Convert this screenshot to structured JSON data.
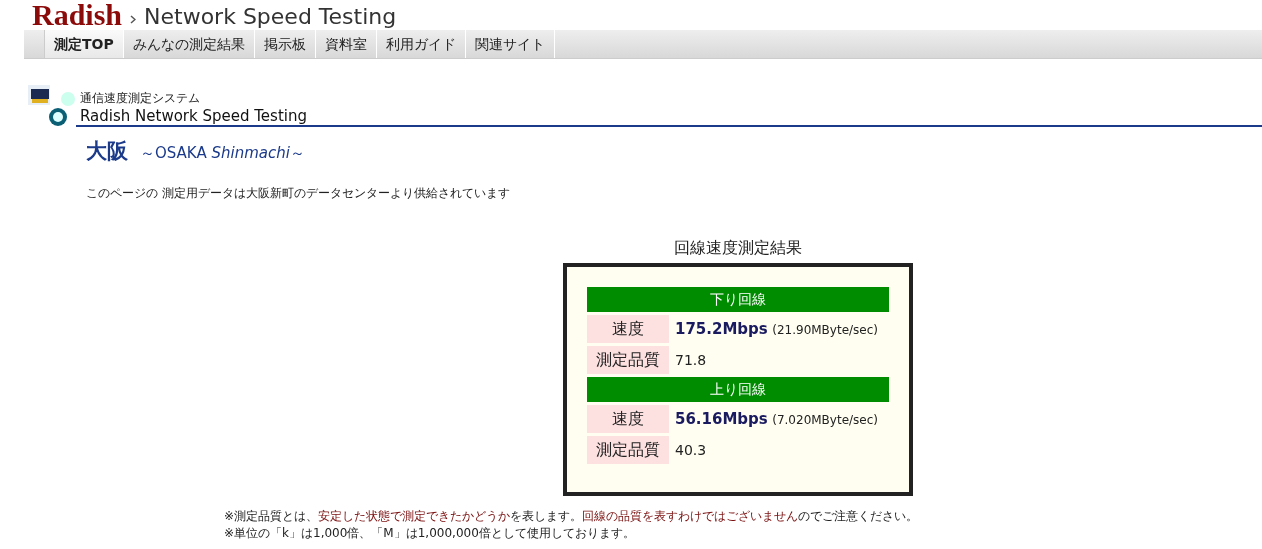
{
  "header": {
    "logo": "Radish",
    "title": "Network Speed Testing"
  },
  "tabs": [
    {
      "label": "測定TOP",
      "selected": true
    },
    {
      "label": "みんなの測定結果",
      "selected": false
    },
    {
      "label": "掲示板",
      "selected": false
    },
    {
      "label": "資料室",
      "selected": false
    },
    {
      "label": "利用ガイド",
      "selected": false
    },
    {
      "label": "関連サイト",
      "selected": false
    }
  ],
  "section": {
    "caption": "通信速度測定システム",
    "title": "Radish Network Speed Testing"
  },
  "location": {
    "name": "大阪",
    "subtitle": "～OSAKA *Shinmachi*～"
  },
  "description": "このページの 測定用データは大阪新町のデータセンターより供給されています",
  "results": {
    "title": "回線速度測定結果",
    "groups": [
      {
        "heading": "下り回線",
        "speed_label": "速度",
        "speed": "175.2Mbps",
        "speed_detail": "(21.90MByte/sec)",
        "quality_label": "測定品質",
        "quality": "71.8"
      },
      {
        "heading": "上り回線",
        "speed_label": "速度",
        "speed": "56.16Mbps",
        "speed_detail": "(7.020MByte/sec)",
        "quality_label": "測定品質",
        "quality": "40.3"
      }
    ]
  },
  "notes": [
    [
      {
        "text": "※測定品質とは、",
        "highlight": false
      },
      {
        "text": "安定した状態で測定できたかどうか",
        "highlight": true
      },
      {
        "text": "を表します。",
        "highlight": false
      },
      {
        "text": "回線の品質を表すわけではございません",
        "highlight": true
      },
      {
        "text": "のでご注意ください。",
        "highlight": false
      }
    ],
    [
      {
        "text": "※単位の「k」は1,000倍、「M」は1,000,000倍として使用しております。",
        "highlight": false
      }
    ]
  ]
}
